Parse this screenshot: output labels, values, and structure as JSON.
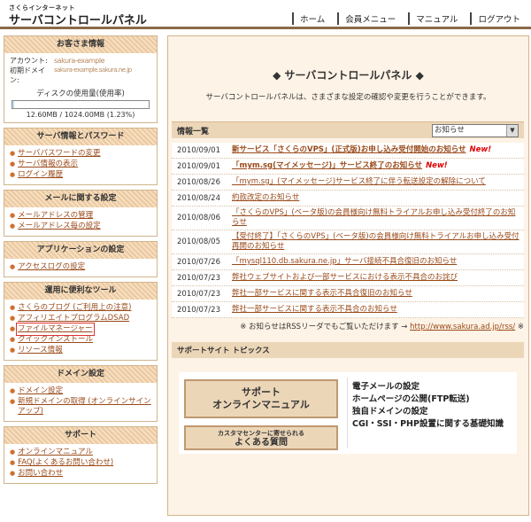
{
  "header": {
    "brand_sub": "さくらインターネット",
    "brand_main": "サーバコントロールパネル",
    "nav": [
      "ホーム",
      "会員メニュー",
      "マニュアル",
      "ログアウト"
    ]
  },
  "customer": {
    "heading": "お客さま情報",
    "account_label": "アカウント:",
    "account_value": "sakura-example",
    "domain_label": "初期ドメイン:",
    "domain_value": "sakura-example.sakura.ne.jp",
    "disk_title": "ディスクの使用量(使用率)",
    "disk_usage_text": "12.60MB / 1024.00MB (1.23%)",
    "disk_percent": 1.23
  },
  "sidebar": {
    "sections": [
      {
        "heading": "サーバ情報とパスワード",
        "items": [
          "サーバパスワードの変更",
          "サーバ情報の表示",
          "ログイン履歴"
        ]
      },
      {
        "heading": "メールに関する設定",
        "items": [
          "メールアドレスの管理",
          "メールアドレス毎の設定"
        ]
      },
      {
        "heading": "アプリケーションの設定",
        "items": [
          "アクセスログの設定"
        ]
      },
      {
        "heading": "運用に便利なツール",
        "items": [
          "さくらのブログ (ご利用上の注意)",
          "アフィリエイトプログラムDSAD",
          "ファイルマネージャー",
          "クイックインストール",
          "リソース情報"
        ]
      },
      {
        "heading": "ドメイン設定",
        "items": [
          "ドメイン設定",
          "新規ドメインの取得 (オンラインサインアップ)"
        ]
      },
      {
        "heading": "サポート",
        "items": [
          "オンラインマニュアル",
          "FAQ(よくあるお問い合わせ)",
          "お問い合わせ"
        ]
      }
    ]
  },
  "main": {
    "title": "◆ サーバコントロールパネル ◆",
    "description": "サーバコントロールパネルは、さまざまな設定の確認や変更を行うことができます。",
    "news_heading": "情報一覧",
    "news_select": "お知らせ",
    "news": [
      {
        "date": "2010/09/01",
        "title": "新サービス「さくらのVPS」(正式版)お申し込み受付開始のお知らせ",
        "new": "New!"
      },
      {
        "date": "2010/09/01",
        "title": "「mym.sg(マイメッセージ)」サービス終了のお知らせ",
        "new": "New!"
      },
      {
        "date": "2010/08/26",
        "title": "「mym.sg」(マイメッセージ)サービス終了に伴う転送設定の解除について",
        "new": ""
      },
      {
        "date": "2010/08/24",
        "title": "約款改定のお知らせ",
        "new": ""
      },
      {
        "date": "2010/08/06",
        "title": "「さくらのVPS」(ベータ版)の会員様向け無料トライアルお申し込み受付終了のお知らせ",
        "new": ""
      },
      {
        "date": "2010/08/05",
        "title": "【受付終了】「さくらのVPS」(ベータ版)の会員様向け無料トライアルお申し込み受付再開のお知らせ",
        "new": ""
      },
      {
        "date": "2010/07/26",
        "title": "「mysql110.db.sakura.ne.jp」サーバ接続不具合復旧のお知らせ",
        "new": ""
      },
      {
        "date": "2010/07/23",
        "title": "弊社ウェブサイトおよび一部サービスにおける表示不具合のお詫び",
        "new": ""
      },
      {
        "date": "2010/07/23",
        "title": "弊社一部サービスに関する表示不具合復旧のお知らせ",
        "new": ""
      },
      {
        "date": "2010/07/23",
        "title": "弊社一部サービスに関する表示不具合のお知らせ",
        "new": ""
      }
    ],
    "rss_prefix": "※ お知らせはRSSリーダでもご覧いただけます →",
    "rss_url": "http://www.sakura.ad.jp/rss/",
    "rss_suffix": "※",
    "support_heading": "サポートサイト トピックス",
    "support_btn1_line1": "サポート",
    "support_btn1_line2": "オンラインマニュアル",
    "support_btn2_small": "カスタマセンターに寄せられる",
    "support_btn2_big": "よくある質問",
    "topics": [
      "電子メールの設定",
      "ホームページの公開(FTP転送)",
      "独自ドメインの設定",
      "CGI・SSI・PHP設置に関する基礎知識"
    ]
  },
  "colors": {
    "accent": "#9a4a1a",
    "panel": "#fdf3e6",
    "header_bar": "#ecd6b8",
    "new_badge": "#e00000"
  }
}
